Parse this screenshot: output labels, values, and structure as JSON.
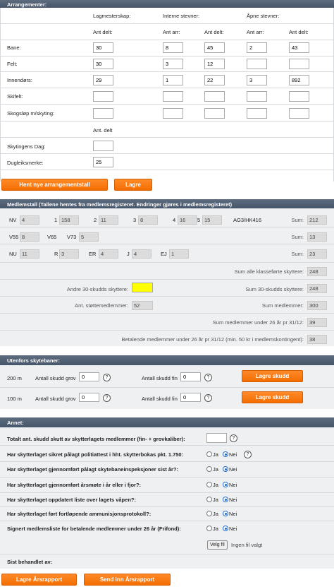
{
  "arrangementer": {
    "header": "Arrangementer:",
    "groups": {
      "lagmesterskap": "Lagmesterskap:",
      "interne": "Interne stevner:",
      "apne": "Åpne stevner:"
    },
    "col_ant_delt": "Ant delt:",
    "col_ant_arr": "Ant arr:",
    "rows": [
      {
        "label": "Bane:",
        "lag": "30",
        "int_arr": "8",
        "int_delt": "45",
        "apne_arr": "2",
        "apne_delt": "43"
      },
      {
        "label": "Felt:",
        "lag": "30",
        "int_arr": "3",
        "int_delt": "12",
        "apne_arr": "",
        "apne_delt": ""
      },
      {
        "label": "Innendørs:",
        "lag": "29",
        "int_arr": "1",
        "int_delt": "22",
        "apne_arr": "3",
        "apne_delt": "892"
      },
      {
        "label": "Skifelt:",
        "lag": "",
        "int_arr": "",
        "int_delt": "",
        "apne_arr": "",
        "apne_delt": ""
      },
      {
        "label": "Skogsløp m/skyting:",
        "lag": "",
        "int_arr": "",
        "int_delt": "",
        "apne_arr": "",
        "apne_delt": ""
      }
    ],
    "ant_delt_label": "Ant. delt",
    "skyttingens_dag_label": "Skytingens Dag:",
    "skyttingens_dag_value": "",
    "dugleiksmerke_label": "Dugleiksmerke:",
    "dugleiksmerke_value": "25",
    "btn_hent": "Hent nye arrangementstall",
    "btn_lagre": "Lagre"
  },
  "medlemstall": {
    "header": "Medlemstall (Tallene hentes fra medlemsregisteret. Endringer gjøres i medlemsregisteret)",
    "classes": [
      {
        "label": "NV",
        "value": "4"
      },
      {
        "label": "1",
        "value": "158"
      },
      {
        "label": "2",
        "value": "11"
      },
      {
        "label": "3",
        "value": "8"
      },
      {
        "label": "4",
        "value": "16"
      },
      {
        "label": "5",
        "value": "15"
      },
      {
        "label": "AG3/HK416",
        "value": ""
      },
      {
        "label": "Sum:",
        "value": "212"
      },
      {
        "label": "V55",
        "value": "8"
      },
      {
        "label": "V65",
        "value": ""
      },
      {
        "label": "V73",
        "value": "5"
      },
      {
        "label": "Sum:",
        "value": "13"
      },
      {
        "label": "NU",
        "value": "11"
      },
      {
        "label": "R",
        "value": "3"
      },
      {
        "label": "ER",
        "value": "4"
      },
      {
        "label": "J",
        "value": "4"
      },
      {
        "label": "EJ",
        "value": "1"
      },
      {
        "label": "Sum:",
        "value": "23"
      }
    ],
    "sum_alle_label": "Sum alle klasseførte skyttere:",
    "sum_alle_value": "248",
    "andre_label": "Andre 30-skudds skyttere:",
    "andre_value": "",
    "sum30_label": "Sum 30-skudds skyttere:",
    "sum30_value": "248",
    "stotte_label": "Ant. støttemedlemmer:",
    "stotte_value": "52",
    "summedl_label": "Sum medlemmer:",
    "summedl_value": "300",
    "under26_label": "Sum medlemmer under 26 år pr 31/12:",
    "under26_value": "39",
    "betalende_label": "Betalende medlemmer under 26 år pr 31/12 (min. 50 kr i medlemskontingent):",
    "betalende_value": "38"
  },
  "utenfors": {
    "header": "Utenfors skytebaner:",
    "rows": [
      {
        "distance": "200 m",
        "grov_label": "Antall skudd grov",
        "grov": "0",
        "fin_label": "Antall skudd fin",
        "fin": "0",
        "btn": "Lagre skudd"
      },
      {
        "distance": "100 m",
        "grov_label": "Antall skudd grov",
        "grov": "0",
        "fin_label": "Antall skudd fin",
        "fin": "0",
        "btn": "Lagre skudd"
      }
    ]
  },
  "annet": {
    "header": "Annet:",
    "totalt_label": "Totalt ant. skudd skutt av skytterlagets medlemmer (fin- + grovkaliber):",
    "totalt_value": "",
    "questions": [
      "Har skytterlaget sikret pålagt politiattest i hht. skytterbokas pkt. 1.750:",
      "Har skytterlaget gjennomført pålagt skytebaneinspeksjoner sist år?:",
      "Har skytterlaget gjennomført årsmøte i år eller i fjor?:",
      "Har skytterlaget oppdatert liste over lagets våpen?:",
      "Har skytterlaget ført fortløpende ammunisjonsprotokoll?:",
      "Signert medlemsliste for betalende medlemmer under 26 år (Frifond):"
    ],
    "ja": "Ja",
    "nei": "Nei",
    "file_button": "Velg fil",
    "file_status": "Ingen fil valgt",
    "sist_behandlet": "Sist behandlet av:"
  },
  "footer": {
    "btn_lagre": "Lagre Årsrapport",
    "btn_send": "Send inn Årsrapport"
  },
  "colors": {
    "accent": "#f36d00",
    "header_bg": "#4e5d70",
    "highlight": "#ffff00"
  }
}
